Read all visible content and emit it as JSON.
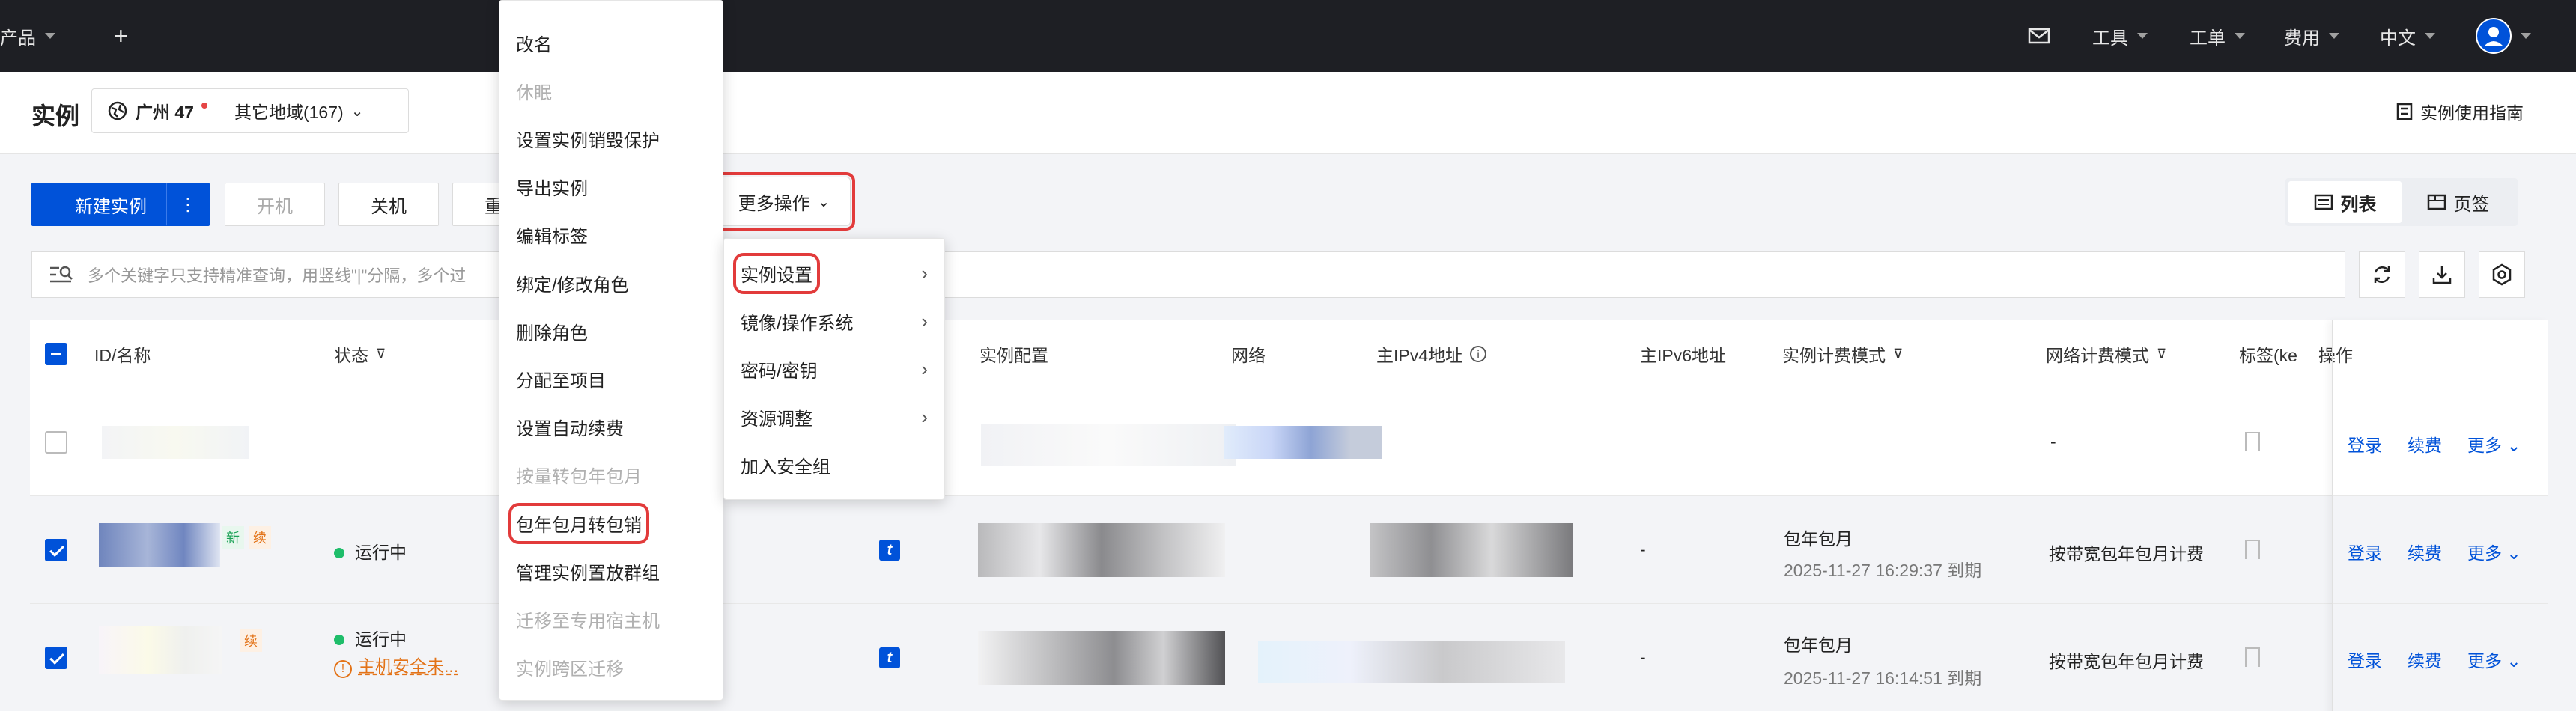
{
  "topbar": {
    "products_label": "云产品",
    "tools": "工具",
    "tickets": "工单",
    "billing": "费用",
    "language": "中文"
  },
  "header": {
    "title": "实例",
    "region": "广州 47",
    "other_regions": "其它地域(167)",
    "guide": "实例使用指南"
  },
  "toolbar": {
    "new_instance": "新建实例",
    "kebab": "⋮",
    "power_on": "开机",
    "power_off": "关机",
    "restart_partial": "重",
    "more_ops": "更多操作"
  },
  "view_toggle": {
    "list": "列表",
    "tabs": "页签"
  },
  "search": {
    "placeholder": "多个关键字只支持精准查询，用竖线\"|\"分隔，多个过"
  },
  "table": {
    "headers": {
      "id_name": "ID/名称",
      "status": "状态",
      "config": "实例配置",
      "network": "网络",
      "ipv4": "主IPv4地址",
      "ipv6": "主IPv6地址",
      "billing_mode": "实例计费模式",
      "net_billing": "网络计费模式",
      "tags": "标签(ke",
      "ops": "操作"
    },
    "rows": [
      {
        "tag_new": "",
        "tag_renew": "",
        "status": "",
        "warning": "",
        "ipv6": "",
        "billing": "",
        "expiry": "",
        "net_billing": "-",
        "login": "登录",
        "renew": "续费",
        "more": "更多"
      },
      {
        "tag_new": "新",
        "tag_renew": "续",
        "status": "运行中",
        "warning": "",
        "ipv6": "-",
        "billing": "包年包月",
        "expiry": "2025-11-27 16:29:37 到期",
        "net_billing": "按带宽包年包月计费",
        "login": "登录",
        "renew": "续费",
        "more": "更多"
      },
      {
        "tag_new": "",
        "tag_renew": "续",
        "status": "运行中",
        "warning": "主机安全未...",
        "ipv6": "-",
        "billing": "包年包月",
        "expiry": "2025-11-27 16:14:51 到期",
        "net_billing": "按带宽包年包月计费",
        "login": "登录",
        "renew": "续费",
        "more": "更多"
      }
    ]
  },
  "left_menu": {
    "items": [
      {
        "label": "改名",
        "disabled": false
      },
      {
        "label": "休眠",
        "disabled": true
      },
      {
        "label": "设置实例销毁保护",
        "disabled": false
      },
      {
        "label": "导出实例",
        "disabled": false
      },
      {
        "label": "编辑标签",
        "disabled": false
      },
      {
        "label": "绑定/修改角色",
        "disabled": false
      },
      {
        "label": "删除角色",
        "disabled": false
      },
      {
        "label": "分配至项目",
        "disabled": false
      },
      {
        "label": "设置自动续费",
        "disabled": false
      },
      {
        "label": "按量转包年包月",
        "disabled": true
      },
      {
        "label": "包年包月转包销",
        "disabled": false,
        "highlighted": true
      },
      {
        "label": "管理实例置放群组",
        "disabled": false
      },
      {
        "label": "迁移至专用宿主机",
        "disabled": true
      },
      {
        "label": "实例跨区迁移",
        "disabled": true
      }
    ]
  },
  "more_menu": {
    "items": [
      {
        "label": "实例设置",
        "submenu": true,
        "highlighted": true
      },
      {
        "label": "镜像/操作系统",
        "submenu": true
      },
      {
        "label": "密码/密钥",
        "submenu": true
      },
      {
        "label": "资源调整",
        "submenu": true
      },
      {
        "label": "加入安全组",
        "submenu": false
      }
    ]
  },
  "colors": {
    "accent": "#0052d9",
    "highlight_outline": "#e23b3b",
    "topbar": "#1e1f24"
  }
}
